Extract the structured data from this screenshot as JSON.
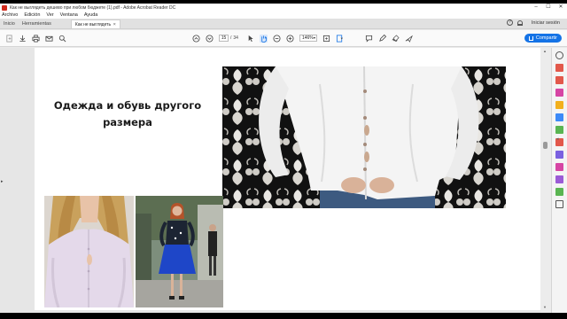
{
  "window": {
    "title": "Как не выглядеть дешево при любом бюджете (1).pdf - Adobe Acrobat Reader DC",
    "minimize": "–",
    "maximize": "☐",
    "close": "✕"
  },
  "menu": [
    "Archivo",
    "Edición",
    "Ver",
    "Ventana",
    "Ayuda"
  ],
  "tabs": {
    "home": "Inicio",
    "tools": "Herramientas",
    "document_tab": "Как не выглядеть ...",
    "close": "×"
  },
  "account": {
    "signin": "Iniciar sesión",
    "help": "?"
  },
  "toolbar": {
    "page_current": "15",
    "page_separator": "/",
    "page_total": "34",
    "zoom": "146%",
    "share_label": "Compartir"
  },
  "document": {
    "slide_title": "Одежда и обувь другого размера"
  },
  "right_pane_icons": [
    "search",
    "export-pdf",
    "create-pdf",
    "edit-pdf",
    "comment",
    "combine",
    "organize",
    "redact",
    "protect",
    "optimize",
    "fill-sign",
    "send-for-signature",
    "more-tools"
  ],
  "colors": {
    "accent": "#1473e6",
    "logo": "#d0291c"
  }
}
